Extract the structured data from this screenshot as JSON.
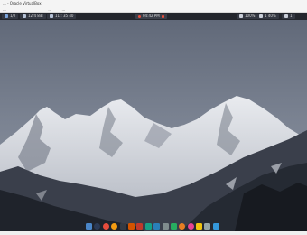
{
  "window": {
    "title": "... - Oracle VirtualBox",
    "menus": [
      "...",
      "...",
      "..."
    ]
  },
  "panel": {
    "workspace": "1/2",
    "memory": "12/4 8iB",
    "clock": "11 : 35 40",
    "date": "04:42 PM",
    "right_1": "100%",
    "right_2": "1 40%",
    "right_3": "1"
  },
  "colors": {
    "panel_bg": "#23262d",
    "pill_bg": "#343842",
    "accent_red": "#e9503d"
  },
  "dock": {
    "apps": [
      {
        "name": "files-icon",
        "color": "#4a86c8",
        "round": false
      },
      {
        "name": "search-icon",
        "color": "#2b3a55",
        "round": true
      },
      {
        "name": "browser-icon",
        "color": "#e74c3c",
        "round": true
      },
      {
        "name": "app-icon",
        "color": "#f39c12",
        "round": true
      },
      {
        "name": "terminal-icon",
        "color": "#333a45",
        "round": false
      },
      {
        "name": "app-icon",
        "color": "#d35400",
        "round": false
      },
      {
        "name": "app-icon",
        "color": "#c0392b",
        "round": false
      },
      {
        "name": "app-icon",
        "color": "#16a085",
        "round": false
      },
      {
        "name": "app-icon",
        "color": "#2980b9",
        "round": false
      },
      {
        "name": "app-icon",
        "color": "#7f8c8d",
        "round": false
      },
      {
        "name": "app-icon",
        "color": "#27ae60",
        "round": false
      },
      {
        "name": "app-icon",
        "color": "#e67e22",
        "round": true
      },
      {
        "name": "app-icon",
        "color": "#e84393",
        "round": true
      },
      {
        "name": "app-icon",
        "color": "#f1c40f",
        "round": false
      },
      {
        "name": "app-icon",
        "color": "#95a5a6",
        "round": false
      },
      {
        "name": "app-icon",
        "color": "#3498db",
        "round": false
      }
    ]
  }
}
